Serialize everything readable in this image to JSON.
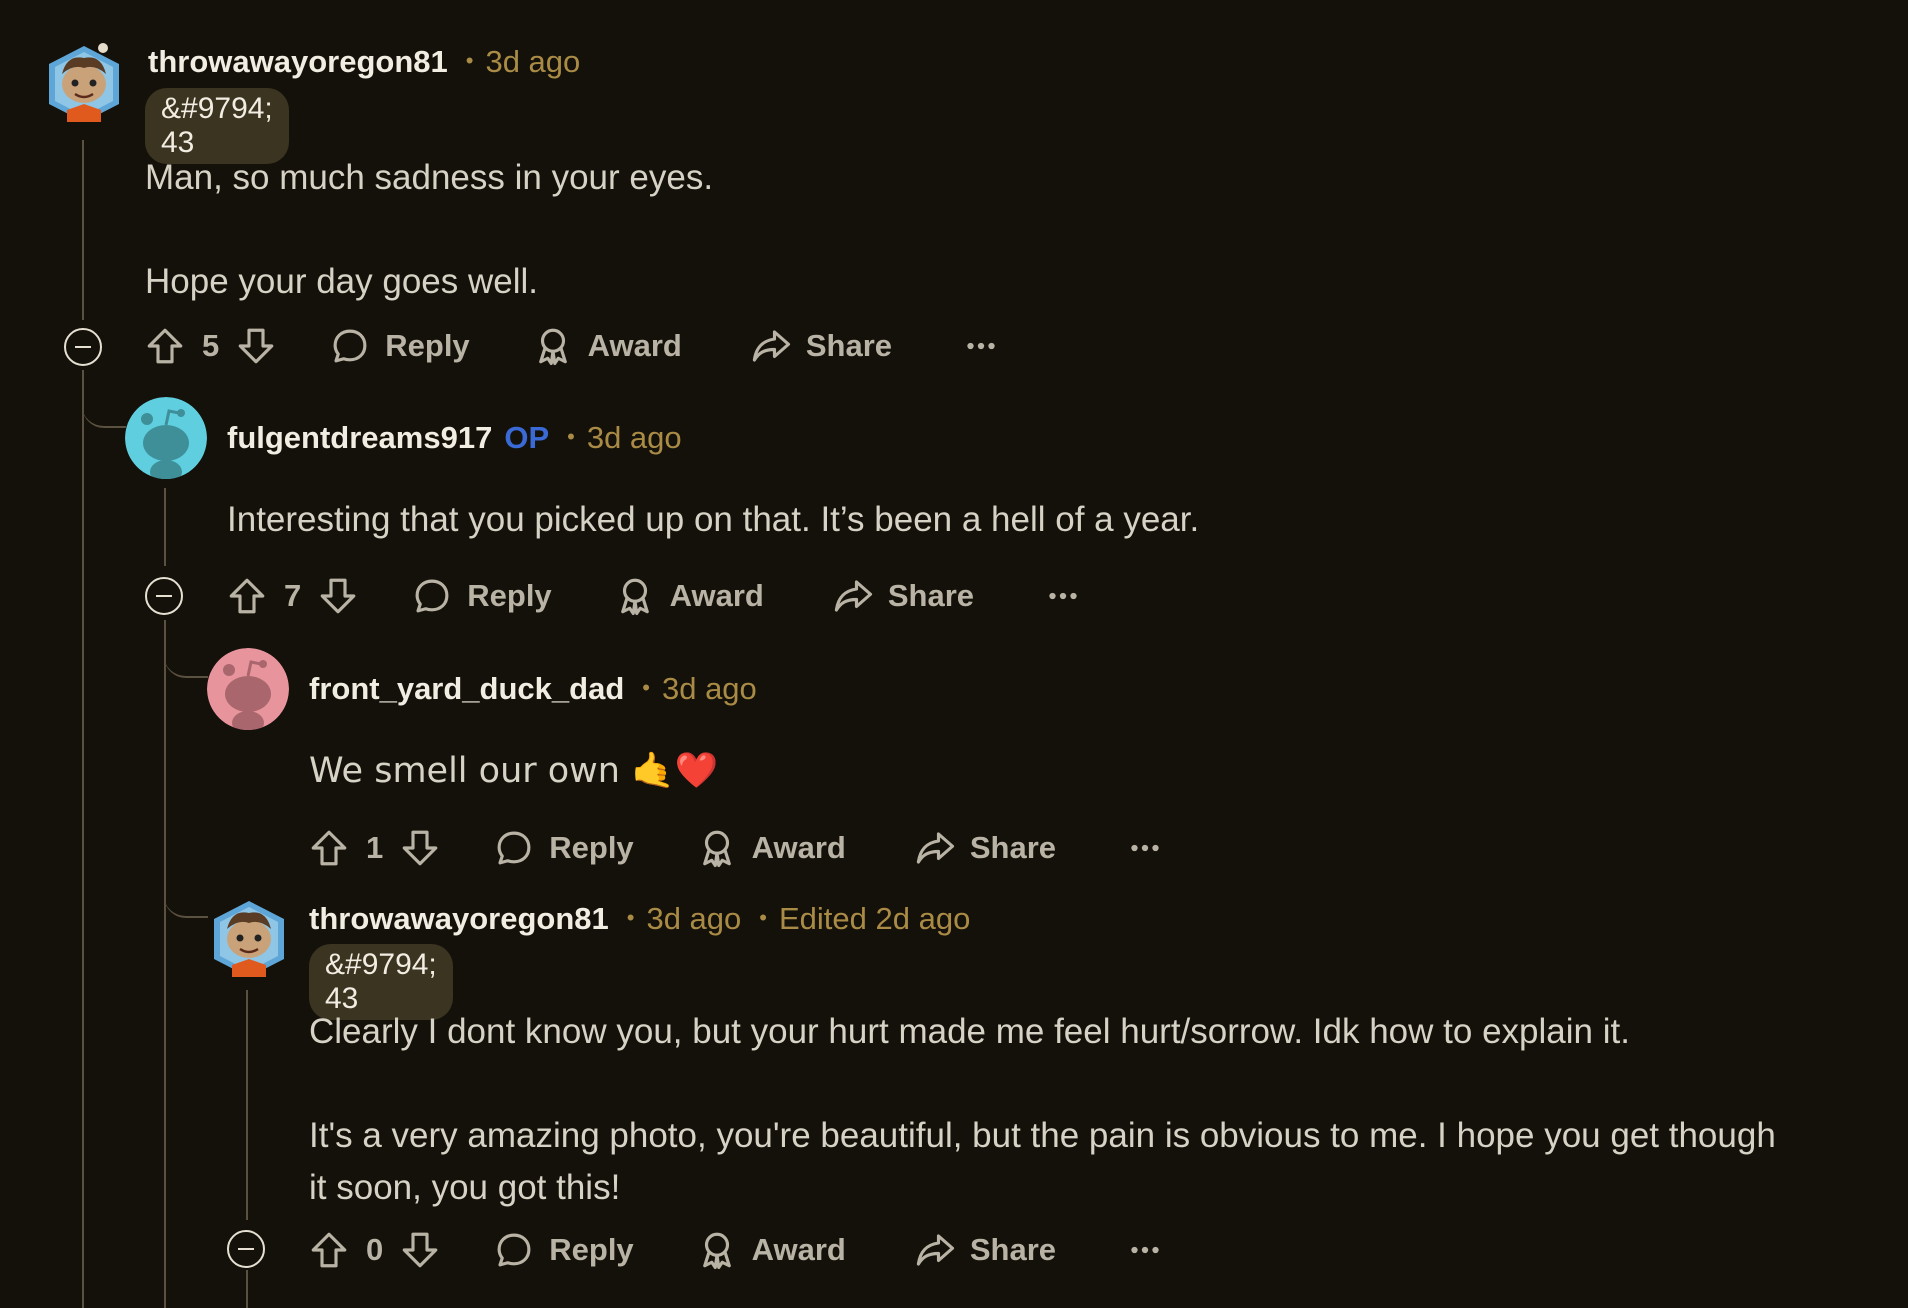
{
  "comments": [
    {
      "username": "throwawayoregon81",
      "time": "3d ago",
      "flair": "&#9794; 43",
      "body": "Man, so much sadness in your eyes.\n\nHope your day goes well.",
      "votes": "5",
      "reply": "Reply",
      "award": "Award",
      "share": "Share"
    },
    {
      "username": "fulgentdreams917",
      "op": "OP",
      "time": "3d ago",
      "body": "Interesting that you picked up on that. It’s been a hell of a year.",
      "votes": "7",
      "reply": "Reply",
      "award": "Award",
      "share": "Share"
    },
    {
      "username": "front_yard_duck_dad",
      "time": "3d ago",
      "body": "We smell our own 🤙❤️",
      "votes": "1",
      "reply": "Reply",
      "award": "Award",
      "share": "Share"
    },
    {
      "username": "throwawayoregon81",
      "time": "3d ago",
      "edited": "Edited 2d ago",
      "flair": "&#9794; 43",
      "body": "Clearly I dont know you, but your hurt made me feel hurt/sorrow. Idk how to explain it.\n\nIt's a very amazing photo, you're beautiful, but the pain is obvious to me. I hope you get though\nit soon, you got this!",
      "votes": "0",
      "reply": "Reply",
      "award": "Award",
      "share": "Share"
    }
  ],
  "icons": {
    "upvote": "upvote-icon",
    "downvote": "downvote-icon",
    "reply": "comment-bubble-icon",
    "award": "award-icon",
    "share": "share-icon",
    "more": "more-horizontal-icon",
    "collapse": "collapse-minus-icon"
  },
  "colors": {
    "background": "#14110a",
    "username": "#f2ede2",
    "meta": "#a98b45",
    "op": "#3a6ad6",
    "flair_bg": "#3b3421"
  }
}
